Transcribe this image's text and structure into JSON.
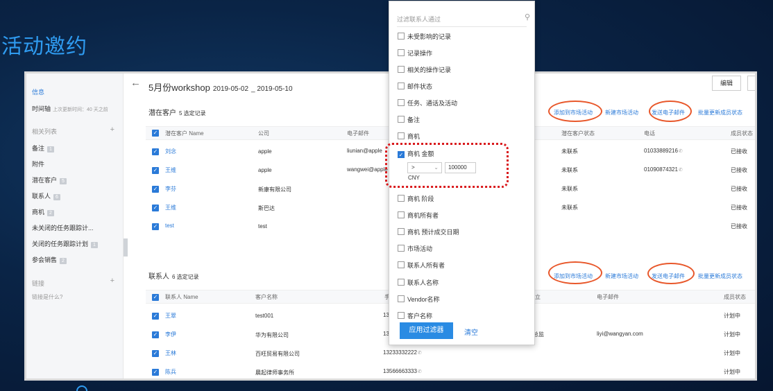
{
  "slide_title": "活动邀约",
  "sidebar": {
    "info": "信息",
    "timeline": "时间轴",
    "timeline_updated": "上次更新时间：40 天之前",
    "related_list": "相关列表",
    "items": [
      {
        "label": "备注",
        "badge": "1"
      },
      {
        "label": "附件",
        "badge": ""
      },
      {
        "label": "潜在客户",
        "badge": "5"
      },
      {
        "label": "联系人",
        "badge": "6"
      },
      {
        "label": "商机",
        "badge": "2"
      },
      {
        "label": "未关闭的任务跟踪计...",
        "badge": ""
      },
      {
        "label": "关闭的任务跟踪计划",
        "badge": "1"
      },
      {
        "label": "参会销售",
        "badge": "2"
      }
    ],
    "links": "链接",
    "links_q": "链接是什么?"
  },
  "header": {
    "title": "5月份workshop",
    "date_start": "2019-05-02",
    "date_end": "_ 2019-05-10",
    "edit": "编辑"
  },
  "leads": {
    "title": "潜在客户",
    "count": "5 选定记录",
    "actions": [
      "添加到市场活动",
      "新建市场活动",
      "发送电子邮件",
      "批量更新成员状态"
    ],
    "columns": [
      "潜在客户 Name",
      "公司",
      "电子邮件",
      "潜在客户状态",
      "电话",
      "成员状态"
    ],
    "rows": [
      {
        "name": "刘念",
        "company": "apple",
        "email": "liunian@apple",
        "status": "未联系",
        "phone": "01033889216",
        "member": "已接收"
      },
      {
        "name": "王维",
        "company": "apple",
        "email": "wangwei@apple",
        "status": "未联系",
        "phone": "01090874321",
        "member": "已接收"
      },
      {
        "name": "李芬",
        "company": "新康有限公司",
        "email": "",
        "status": "未联系",
        "phone": "",
        "member": "已接收"
      },
      {
        "name": "王维",
        "company": "斯巴达",
        "email": "",
        "status": "未联系",
        "phone": "",
        "member": "已接收"
      },
      {
        "name": "test",
        "company": "test",
        "email": "",
        "status": "",
        "phone": "",
        "member": "已接收"
      }
    ]
  },
  "contacts": {
    "title": "联系人",
    "count": "6 选定记录",
    "actions": [
      "添加到市场活动",
      "新建市场活动",
      "发送电子邮件",
      "批量更新成员状态"
    ],
    "columns": [
      "联系人 Name",
      "客户名称",
      "手",
      "立",
      "电子邮件",
      "成员状态"
    ],
    "rows": [
      {
        "name": "王翠",
        "account": "test001",
        "phone": "13",
        "title": "",
        "email": "",
        "member": "计划中"
      },
      {
        "name": "李伊",
        "account": "华为有限公司",
        "phone": "13",
        "title": "总监",
        "email": "liyi@wangyan.com",
        "member": "计划中"
      },
      {
        "name": "王林",
        "account": "百旺贸易有限公司",
        "phone": "13233332222",
        "title": "",
        "email": "",
        "member": "计划中"
      },
      {
        "name": "陈兵",
        "account": "晨起律师事务所",
        "phone": "13566663333",
        "title": "",
        "email": "",
        "member": "计划中"
      }
    ]
  },
  "filter": {
    "search_placeholder": "过滤联系人通过",
    "options": [
      {
        "label": "未受影响的记录",
        "checked": false
      },
      {
        "label": "记录操作",
        "checked": false
      },
      {
        "label": "相关的操作记录",
        "checked": false
      },
      {
        "label": "邮件状态",
        "checked": false
      },
      {
        "label": "任务、通话及活动",
        "checked": false
      },
      {
        "label": "备注",
        "checked": false
      },
      {
        "label": "商机",
        "checked": false
      },
      {
        "label": "商机 金额",
        "checked": true
      },
      {
        "label": "商机 阶段",
        "checked": false
      },
      {
        "label": "商机所有者",
        "checked": false
      },
      {
        "label": "商机 预计成交日期",
        "checked": false
      },
      {
        "label": "市场活动",
        "checked": false
      },
      {
        "label": "联系人所有者",
        "checked": false
      },
      {
        "label": "联系人名称",
        "checked": false
      },
      {
        "label": "Vendor名称",
        "checked": false
      },
      {
        "label": "客户名称",
        "checked": false
      }
    ],
    "amount_operator": ">",
    "amount_value": "100000",
    "amount_currency": "CNY",
    "apply": "应用过滤器",
    "clear": "清空"
  },
  "colors": {
    "accent": "#2a7ad8",
    "highlight_circle": "#e8572a",
    "dashed_box": "#d9191c"
  }
}
